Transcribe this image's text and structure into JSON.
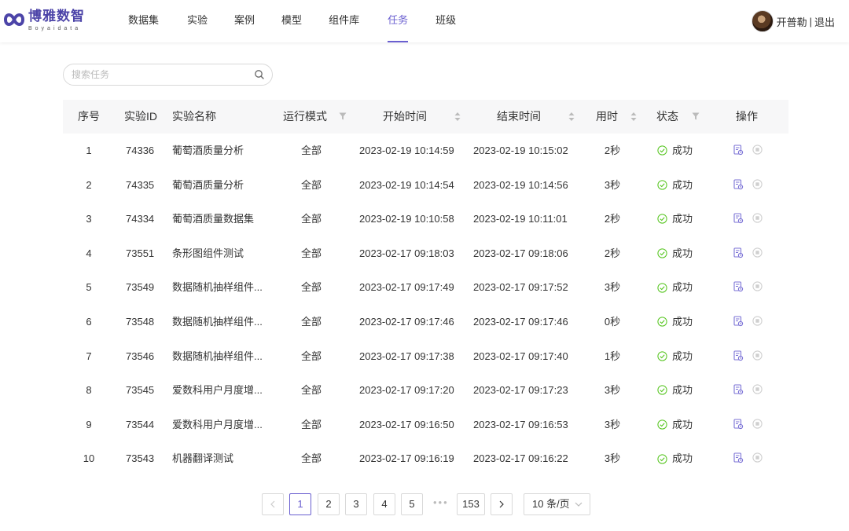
{
  "brand": {
    "name_cn": "博雅数智",
    "name_en": "Boyaidata",
    "color": "#4c44a8"
  },
  "nav": {
    "items": [
      {
        "label": "数据集"
      },
      {
        "label": "实验"
      },
      {
        "label": "案例"
      },
      {
        "label": "模型"
      },
      {
        "label": "组件库"
      },
      {
        "label": "任务",
        "active": true
      },
      {
        "label": "班级"
      }
    ],
    "active_color": "#6a5fd0"
  },
  "user": {
    "name": "开普勒",
    "separator": "|",
    "logout": "退出"
  },
  "search": {
    "placeholder": "搜索任务",
    "value": ""
  },
  "table": {
    "columns": [
      "序号",
      "实验ID",
      "实验名称",
      "运行模式",
      "开始时间",
      "结束时间",
      "用时",
      "状态",
      "操作"
    ],
    "rows": [
      {
        "no": "1",
        "id": "74336",
        "name": "葡萄酒质量分析",
        "mode": "全部",
        "start": "2023-02-19 10:14:59",
        "end": "2023-02-19 10:15:02",
        "duration": "2秒",
        "status": "成功"
      },
      {
        "no": "2",
        "id": "74335",
        "name": "葡萄酒质量分析",
        "mode": "全部",
        "start": "2023-02-19 10:14:54",
        "end": "2023-02-19 10:14:56",
        "duration": "3秒",
        "status": "成功"
      },
      {
        "no": "3",
        "id": "74334",
        "name": "葡萄酒质量数据集",
        "mode": "全部",
        "start": "2023-02-19 10:10:58",
        "end": "2023-02-19 10:11:01",
        "duration": "2秒",
        "status": "成功"
      },
      {
        "no": "4",
        "id": "73551",
        "name": "条形图组件测试",
        "mode": "全部",
        "start": "2023-02-17 09:18:03",
        "end": "2023-02-17 09:18:06",
        "duration": "2秒",
        "status": "成功"
      },
      {
        "no": "5",
        "id": "73549",
        "name": "数据随机抽样组件...",
        "mode": "全部",
        "start": "2023-02-17 09:17:49",
        "end": "2023-02-17 09:17:52",
        "duration": "3秒",
        "status": "成功"
      },
      {
        "no": "6",
        "id": "73548",
        "name": "数据随机抽样组件...",
        "mode": "全部",
        "start": "2023-02-17 09:17:46",
        "end": "2023-02-17 09:17:46",
        "duration": "0秒",
        "status": "成功"
      },
      {
        "no": "7",
        "id": "73546",
        "name": "数据随机抽样组件...",
        "mode": "全部",
        "start": "2023-02-17 09:17:38",
        "end": "2023-02-17 09:17:40",
        "duration": "1秒",
        "status": "成功"
      },
      {
        "no": "8",
        "id": "73545",
        "name": "爱数科用户月度增...",
        "mode": "全部",
        "start": "2023-02-17 09:17:20",
        "end": "2023-02-17 09:17:23",
        "duration": "3秒",
        "status": "成功"
      },
      {
        "no": "9",
        "id": "73544",
        "name": "爱数科用户月度增...",
        "mode": "全部",
        "start": "2023-02-17 09:16:50",
        "end": "2023-02-17 09:16:53",
        "duration": "3秒",
        "status": "成功"
      },
      {
        "no": "10",
        "id": "73543",
        "name": "机器翻译测试",
        "mode": "全部",
        "start": "2023-02-17 09:16:19",
        "end": "2023-02-17 09:16:22",
        "duration": "3秒",
        "status": "成功"
      }
    ],
    "status_color": "#52c41a",
    "action_icons": [
      "view-log-icon",
      "stop-icon"
    ]
  },
  "pagination": {
    "prev": "<",
    "pages": [
      "1",
      "2",
      "3",
      "4",
      "5"
    ],
    "ellipsis": "•••",
    "last": "153",
    "next": ">",
    "page_size": "10 条/页",
    "current": 1
  }
}
